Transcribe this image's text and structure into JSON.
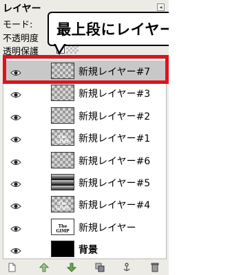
{
  "panel": {
    "title": "レイヤー",
    "dock_glyph": "◂",
    "mode_label": "モード:",
    "opacity_label": "不透明度",
    "lock_label": "透明保護"
  },
  "callout": {
    "text": "最上段にレイヤーを作成"
  },
  "layers": [
    {
      "name": "新規レイヤー#7",
      "thumb": "checker",
      "thumb_text": "",
      "selected": true,
      "bold": false
    },
    {
      "name": "新規レイヤー#3",
      "thumb": "checker",
      "thumb_text": "",
      "selected": false,
      "bold": false
    },
    {
      "name": "新規レイヤー#2",
      "thumb": "checker",
      "thumb_text": "",
      "selected": false,
      "bold": false
    },
    {
      "name": "新規レイヤー#1",
      "thumb": "checker",
      "thumb_text": "The GIMP",
      "selected": false,
      "bold": false
    },
    {
      "name": "新規レイヤー#6",
      "thumb": "checker",
      "thumb_text": "",
      "selected": false,
      "bold": false
    },
    {
      "name": "新規レイヤー#5",
      "thumb": "gradient",
      "thumb_text": "",
      "selected": false,
      "bold": false
    },
    {
      "name": "新規レイヤー#4",
      "thumb": "checker",
      "thumb_text": "The GIMP",
      "selected": false,
      "bold": false
    },
    {
      "name": "新規レイヤー",
      "thumb": "white",
      "thumb_text": "The GIMP",
      "selected": false,
      "bold": false
    },
    {
      "name": "背景",
      "thumb": "black",
      "thumb_text": "",
      "selected": false,
      "bold": true
    }
  ],
  "toolbar": {
    "buttons": [
      "new-layer-icon",
      "raise-layer-icon",
      "lower-layer-icon",
      "duplicate-layer-icon",
      "anchor-layer-icon",
      "delete-layer-icon"
    ]
  },
  "colors": {
    "highlight_border": "#e0121b",
    "selected_row": "#c8c8c8",
    "panel_bg": "#ecebe6"
  }
}
